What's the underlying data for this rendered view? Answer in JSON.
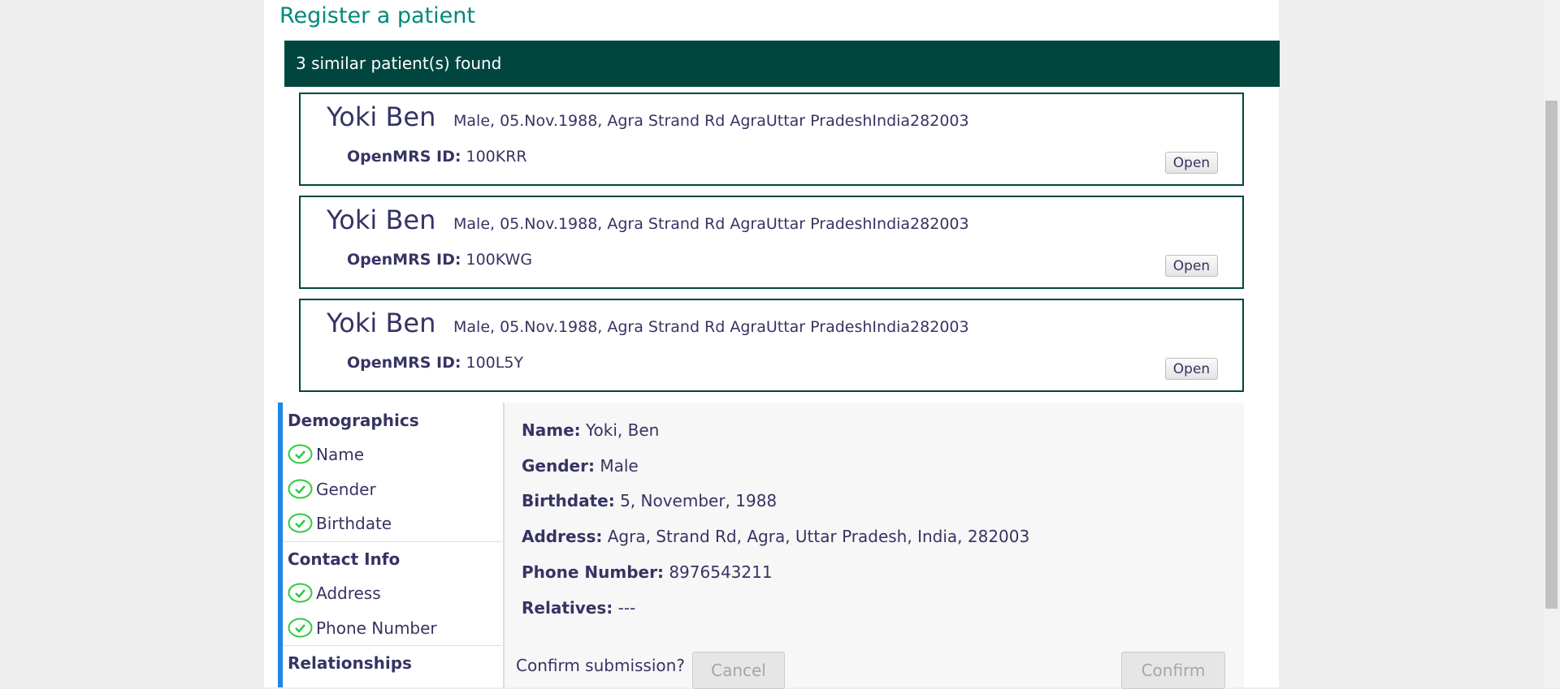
{
  "page": {
    "title": "Register a patient"
  },
  "similar": {
    "banner": "3 similar patient(s) found",
    "id_label": "OpenMRS ID:",
    "open_label": "Open",
    "patients": [
      {
        "name": "Yoki Ben",
        "info": "Male, 05.Nov.1988, Agra Strand Rd AgraUttar PradeshIndia282003",
        "id": "100KRR"
      },
      {
        "name": "Yoki Ben",
        "info": "Male, 05.Nov.1988, Agra Strand Rd AgraUttar PradeshIndia282003",
        "id": "100KWG"
      },
      {
        "name": "Yoki Ben",
        "info": "Male, 05.Nov.1988, Agra Strand Rd AgraUttar PradeshIndia282003",
        "id": "100L5Y"
      }
    ]
  },
  "sidebar": {
    "demographics": "Demographics",
    "name": "Name",
    "gender": "Gender",
    "birthdate": "Birthdate",
    "contact": "Contact Info",
    "address": "Address",
    "phone": "Phone Number",
    "relationships": "Relationships"
  },
  "summary": {
    "name_label": "Name:",
    "name_value": "Yoki, Ben",
    "gender_label": "Gender:",
    "gender_value": "Male",
    "birthdate_label": "Birthdate:",
    "birthdate_value": "5, November, 1988",
    "address_label": "Address:",
    "address_value": "Agra, Strand Rd, Agra, Uttar Pradesh, India, 282003",
    "phone_label": "Phone Number:",
    "phone_value": "8976543211",
    "relatives_label": "Relatives:",
    "relatives_value": "---"
  },
  "confirm": {
    "question": "Confirm submission?",
    "cancel": "Cancel",
    "confirm": "Confirm"
  },
  "colors": {
    "title": "#00897b",
    "banner": "#00463f",
    "accent": "#1e88e5",
    "check": "#2ecc40"
  }
}
